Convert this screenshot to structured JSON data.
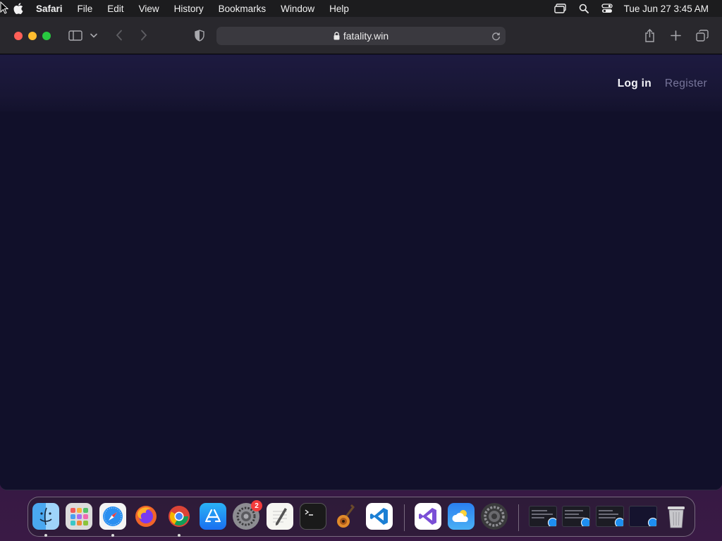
{
  "menubar": {
    "app_name": "Safari",
    "items": [
      "File",
      "Edit",
      "View",
      "History",
      "Bookmarks",
      "Window",
      "Help"
    ],
    "clock": "Tue Jun 27  3:45 AM"
  },
  "browser": {
    "url": "fatality.win"
  },
  "site": {
    "login_label": "Log in",
    "register_label": "Register"
  },
  "dock": {
    "apps": [
      "finder",
      "launchpad",
      "safari",
      "firefox",
      "chrome",
      "app-store",
      "system-preferences",
      "textedit",
      "terminal",
      "garageband",
      "vscode",
      "visual-studio",
      "weather",
      "settings"
    ],
    "system_preferences_badge": "2"
  },
  "colors": {
    "page_bg": "#11102a",
    "header_bg": "#1d1a40",
    "register_text": "#77759a"
  }
}
